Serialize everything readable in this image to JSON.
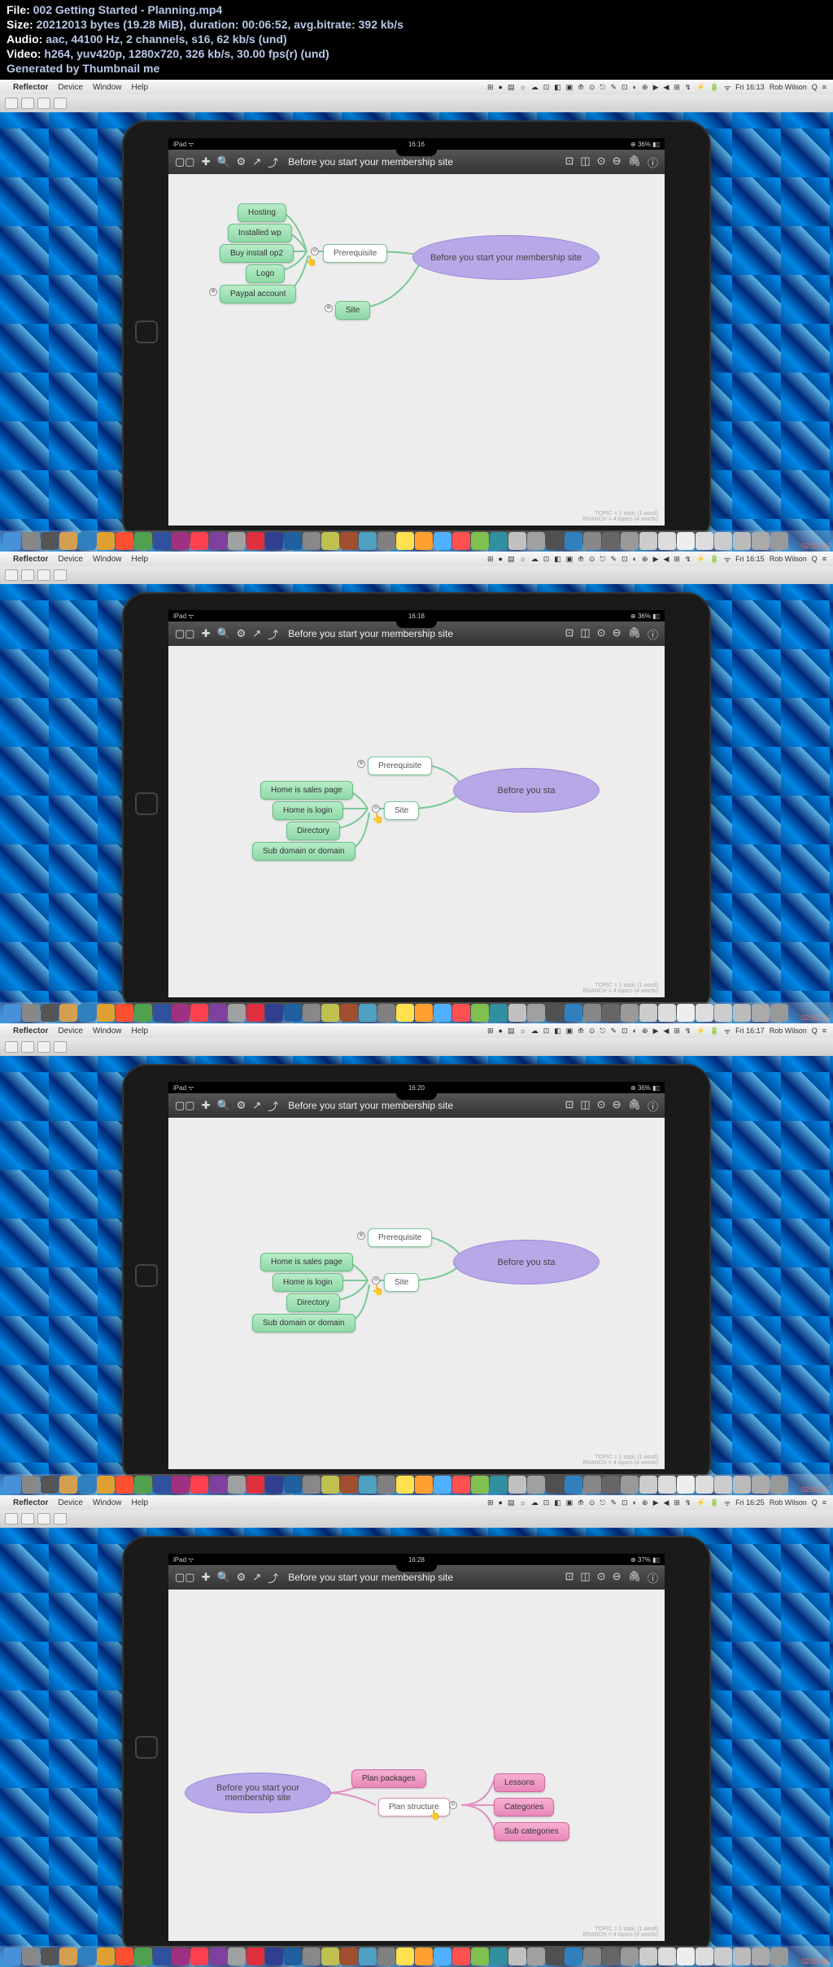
{
  "header": {
    "file_label": "File:",
    "file_value": "002 Getting Started - Planning.mp4",
    "size_label": "Size:",
    "size_value": "20212013 bytes (19.28 MiB), duration: 00:06:52, avg.bitrate: 392 kb/s",
    "audio_label": "Audio:",
    "audio_value": "aac, 44100 Hz, 2 channels, s16, 62 kb/s (und)",
    "video_label": "Video:",
    "video_value": "h264, yuv420p, 1280x720, 326 kb/s, 30.00 fps(r) (und)",
    "generated": "Generated by Thumbnail me"
  },
  "menubar": {
    "app": "Reflector",
    "items": [
      "Device",
      "Window",
      "Help"
    ],
    "user": "Rob Wilson"
  },
  "screens": [
    {
      "time_mac": "Fri 16:13",
      "time_ipad": "16:16",
      "battery": "36%",
      "title": "Before you start your membership site",
      "central": "Before you start your membership site",
      "central_side": "right",
      "watermark": "02:03:16",
      "layout": "s1"
    },
    {
      "time_mac": "Fri 16:15",
      "time_ipad": "16:18",
      "battery": "36%",
      "title": "Before you start your membership site",
      "central": "Before you start",
      "central_side": "right",
      "watermark": "02:03:16",
      "layout": "s2"
    },
    {
      "time_mac": "Fri 16:17",
      "time_ipad": "16:20",
      "battery": "36%",
      "title": "Before you start your membership site",
      "central": "Before you start",
      "central_side": "right",
      "watermark": "02:03:07",
      "layout": "s2"
    },
    {
      "time_mac": "Fri 16:25",
      "time_ipad": "16:28",
      "battery": "37%",
      "title": "Before you start your membership site",
      "central": "Before you start your membership site",
      "central_side": "left",
      "watermark": "02:03:45",
      "layout": "s4"
    }
  ],
  "nodes": {
    "hosting": "Hosting",
    "installed_wp": "Installed wp",
    "buy_install_op2": "Buy install op2",
    "logo": "Logo",
    "paypal": "Paypal account",
    "prerequisite": "Prerequisite",
    "site": "Site",
    "home_sales": "Home is sales page",
    "home_login": "Home is login",
    "directory": "Directory",
    "subdomain": "Sub domain or domain",
    "plan_packages": "Plan packages",
    "plan_structure": "Plan structure",
    "lessons": "Lessons",
    "categories": "Categories",
    "sub_categories": "Sub categories"
  },
  "footer": {
    "line1": "TOPIC = 1 topic (1 word)",
    "line2": "BRANCH = 4 topics (4 words)"
  },
  "dock_colors": [
    "#4a90d9",
    "#888",
    "#555",
    "#d4a050",
    "#3080c0",
    "#e0a030",
    "#ff5030",
    "#50a050",
    "#3050a0",
    "#a03080",
    "#ff4050",
    "#8040a0",
    "#a0a0a0",
    "#e03040",
    "#304090",
    "#2060a0",
    "#888",
    "#c0c050",
    "#a05030",
    "#50a0c0",
    "#808080",
    "#ffe050",
    "#ffa030",
    "#50b0ff",
    "#ff5050",
    "#80c050",
    "#3090a0",
    "#c0c0c0",
    "#a0a0a0",
    "#505050",
    "#3080c0",
    "#888",
    "#666",
    "#999",
    "#ccc",
    "#ddd",
    "#eee",
    "#ddd",
    "#ccc",
    "#bbb",
    "#aaa",
    "#999"
  ]
}
